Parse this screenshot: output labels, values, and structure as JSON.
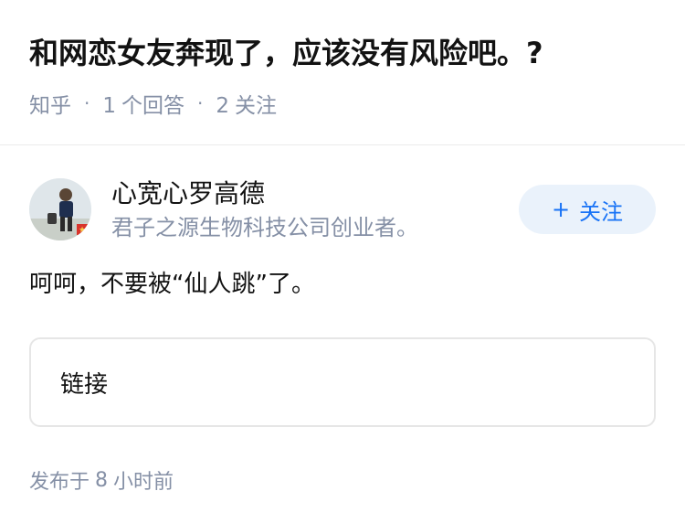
{
  "question": {
    "title": "和网恋女友奔现了，应该没有风险吧。?",
    "source": "知乎",
    "answer_count": "1",
    "answer_label": "个回答",
    "follower_count": "2",
    "follower_label": "关注"
  },
  "answer": {
    "author": {
      "name": "心宽心罗高德",
      "bio": "君子之源生物科技公司创业者。",
      "avatar_icon": "user-avatar"
    },
    "follow_button": {
      "icon": "plus-icon",
      "plus": "+",
      "label": "关注",
      "color": "#1772f6"
    },
    "content": "呵呵，不要被“仙人跳”了。",
    "link_card": {
      "label": "链接"
    },
    "publish": {
      "prefix": "发布于",
      "amount": "8",
      "unit": "小时前"
    }
  }
}
